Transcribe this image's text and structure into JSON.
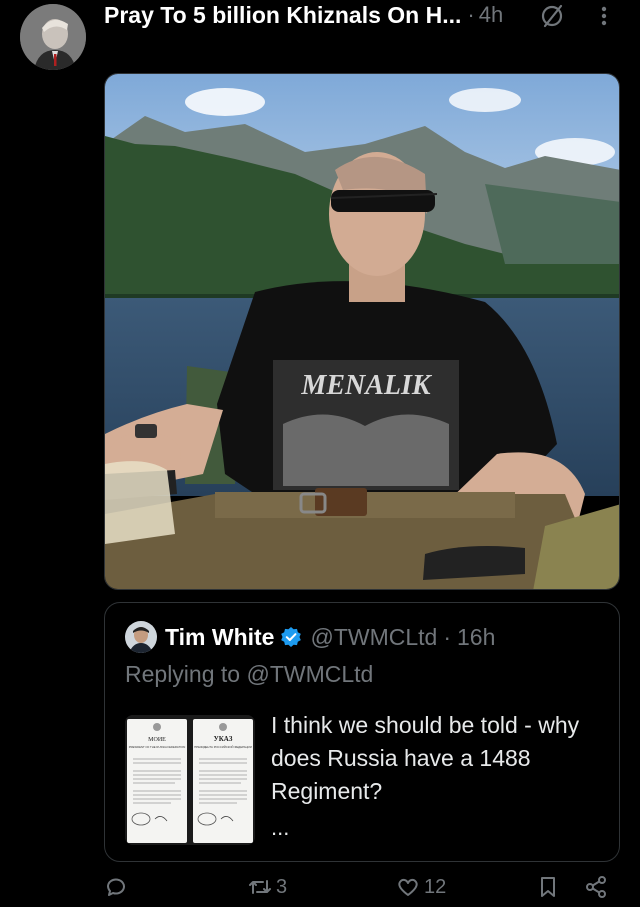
{
  "post": {
    "display_name": "Pray To 5 billion Khiznals On H...",
    "separator": "·",
    "time": "4h"
  },
  "quote": {
    "name": "Tim White",
    "handle": "@TWMCLtd",
    "separator": "·",
    "time": "16h",
    "replying_label": "Replying to",
    "replying_handle": "@TWMCLtd",
    "text": "I think we should be told - why does Russia have a 1488 Regiment?",
    "ellipsis": "..."
  },
  "shirt_text": "MENALIK",
  "document": {
    "left_heading": "МОИЕ",
    "right_heading": "УКАЗ",
    "left_subtitle": "PRESIDENT OF THE RUSSIA FEDERATION",
    "right_subtitle": "ПРЕЗИДЕНТА РОССИЙСКОЙ ФЕДЕРАЦИИ"
  },
  "actions": {
    "retweets": "3",
    "likes": "12"
  },
  "colors": {
    "background": "#000000",
    "muted": "#71767b",
    "verified": "#1d9bf0"
  }
}
